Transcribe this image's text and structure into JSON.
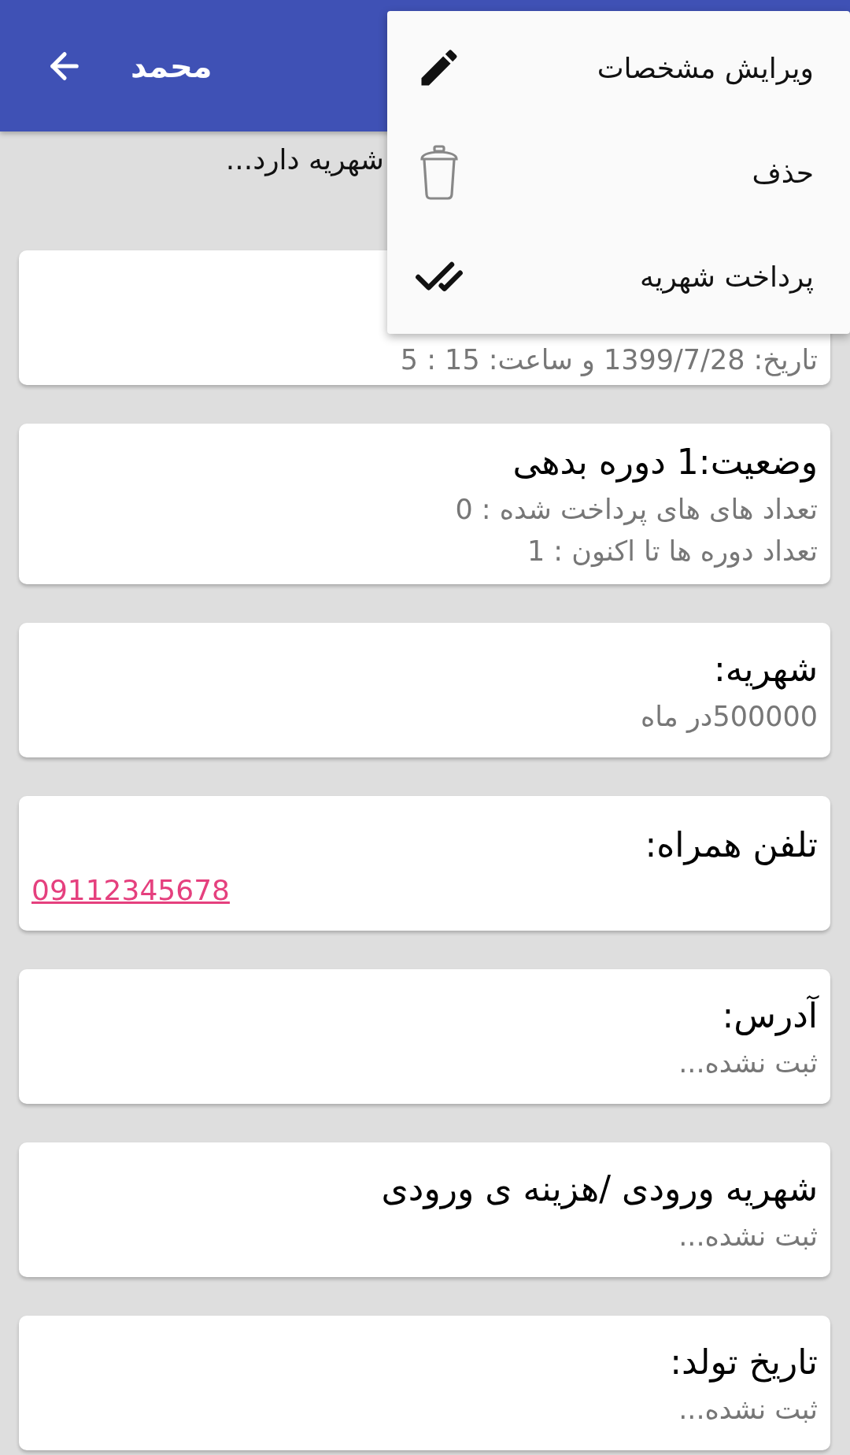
{
  "header": {
    "title": "محمد"
  },
  "notice": "شهریه دارد...",
  "menu": {
    "items": [
      {
        "kind": "edit",
        "label": "ویرایش مشخصات"
      },
      {
        "kind": "delete",
        "label": "حذف"
      },
      {
        "kind": "pay",
        "label": "پرداخت شهریه"
      }
    ]
  },
  "cards": [
    {
      "lines": [
        {
          "kind": "sub",
          "text": "تاریخ: 1399/7/28  و ساعت: 15 : 5"
        }
      ]
    },
    {
      "lines": [
        {
          "kind": "title",
          "text": "وضعیت:1 دوره بدهی"
        },
        {
          "kind": "sub",
          "text": "تعداد های های پرداخت شده : 0"
        },
        {
          "kind": "sub",
          "text": "تعداد دوره ها تا اکنون : 1"
        }
      ]
    },
    {
      "lines": [
        {
          "kind": "title",
          "text": "شهریه:"
        },
        {
          "kind": "sub",
          "text": "500000در ماه"
        }
      ]
    },
    {
      "lines": [
        {
          "kind": "title",
          "text": "تلفن همراه:"
        },
        {
          "kind": "link",
          "text": "09112345678"
        }
      ]
    },
    {
      "lines": [
        {
          "kind": "title",
          "text": "آدرس:"
        },
        {
          "kind": "sub",
          "text": "ثبت نشده..."
        }
      ]
    },
    {
      "lines": [
        {
          "kind": "title",
          "text": "شهریه ورودی /هزینه ی ورودی"
        },
        {
          "kind": "sub",
          "text": "ثبت نشده..."
        }
      ]
    },
    {
      "lines": [
        {
          "kind": "title",
          "text": "تاریخ تولد:"
        },
        {
          "kind": "sub",
          "text": "ثبت نشده..."
        }
      ]
    }
  ]
}
